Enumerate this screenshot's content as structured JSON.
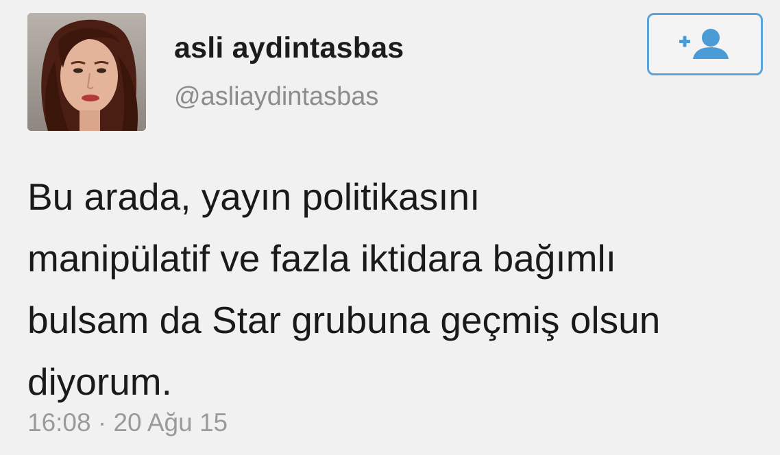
{
  "tweet": {
    "author": {
      "display_name": "asli aydintasbas",
      "handle": "@asliaydintasbas"
    },
    "follow_button": {
      "icon": "add-user-icon",
      "accent_color": "#5ba3d8"
    },
    "text_lines": [
      "Bu arada, yayın politikasını",
      "manipülatif ve fazla iktidara bağımlı",
      "bulsam da Star grubuna geçmiş olsun",
      "diyorum."
    ],
    "timestamp": "16:08 · 20 Ağu 15"
  }
}
